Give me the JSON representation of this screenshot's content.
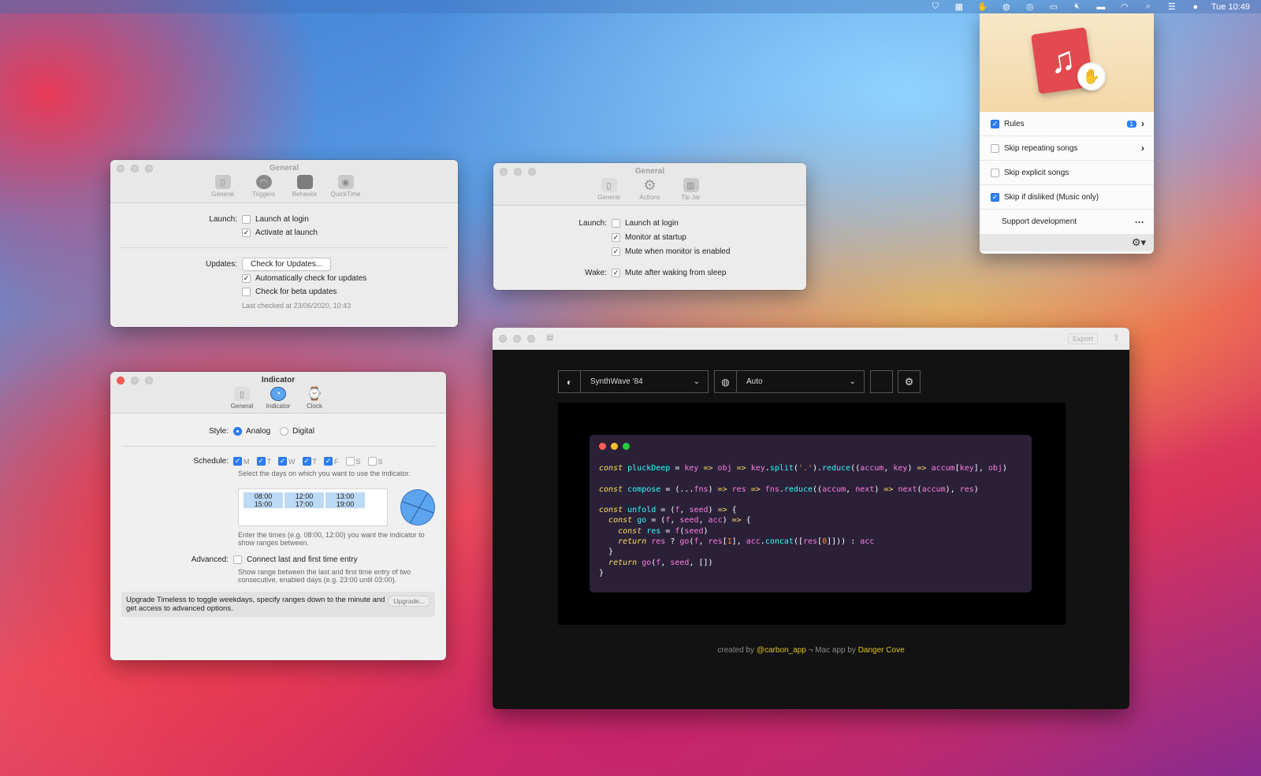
{
  "menubar": {
    "icons": [
      "shield-icon",
      "grid-icon",
      "hand-icon",
      "globe-icon",
      "target-icon",
      "display-icon",
      "mute-icon",
      "battery-icon",
      "wifi-icon",
      "search-icon",
      "control-center-icon",
      "siri-icon"
    ],
    "clock": "Tue 10:49"
  },
  "popover": {
    "items": [
      {
        "label": "Rules",
        "checked": true,
        "badge": "1",
        "chevron": true
      },
      {
        "label": "Skip repeating songs",
        "checked": false,
        "chevron": true
      },
      {
        "label": "Skip explicit songs",
        "checked": false
      },
      {
        "label": "Skip if disliked (Music only)",
        "checked": true
      },
      {
        "label": "Support development",
        "more": "···"
      }
    ]
  },
  "win_general1": {
    "title": "General",
    "tabs": [
      "General",
      "Triggers",
      "Behavior",
      "QuickTime"
    ],
    "launch_label": "Launch:",
    "launch_at_login": "Launch at login",
    "activate_at_launch": "Activate at launch",
    "updates_label": "Updates:",
    "check_updates_button": "Check for Updates...",
    "auto_check": "Automatically check for updates",
    "beta": "Check for beta updates",
    "last_checked": "Last checked at 23/06/2020, 10:43"
  },
  "win_general2": {
    "title": "General",
    "tabs": [
      "General",
      "Actions",
      "Tip Jar"
    ],
    "launch_label": "Launch:",
    "launch_at_login": "Launch at login",
    "monitor_startup": "Monitor at startup",
    "mute_enabled": "Mute when monitor is enabled",
    "wake_label": "Wake:",
    "mute_wake": "Mute after waking from sleep"
  },
  "win_indicator": {
    "title": "Indicator",
    "tabs": [
      "General",
      "Indicator",
      "Clock"
    ],
    "style_label": "Style:",
    "analog": "Analog",
    "digital": "Digital",
    "schedule_label": "Schedule:",
    "days": [
      {
        "d": "M",
        "on": true
      },
      {
        "d": "T",
        "on": true
      },
      {
        "d": "W",
        "on": true
      },
      {
        "d": "T",
        "on": true
      },
      {
        "d": "F",
        "on": true
      },
      {
        "d": "S",
        "on": false
      },
      {
        "d": "S",
        "on": false
      }
    ],
    "schedule_hint": "Select the days on which you want to use the indicator.",
    "times": [
      "08:00",
      "12:00",
      "13:00",
      "15:00",
      "17:00",
      "19:00"
    ],
    "times_hint": "Enter the times (e.g. 08:00, 12:00) you want the indicator to show ranges between.",
    "advanced_label": "Advanced:",
    "connect": "Connect last and first time entry",
    "advanced_hint": "Show range between the last and first time entry of two consecutive, enabled days (e.g. 23:00 until 03:00).",
    "upgrade_text": "Upgrade Timeless to toggle weekdays, specify ranges down to the minute and get access to advanced options.",
    "upgrade_button": "Upgrade..."
  },
  "carbon": {
    "export": "Export",
    "theme": "SynthWave '84",
    "language": "Auto",
    "code_lines": [
      [
        [
          "kw",
          "const"
        ],
        [
          "t",
          " "
        ],
        [
          "fn",
          "pluckDeep"
        ],
        [
          "t",
          " = "
        ],
        [
          "pm",
          "key"
        ],
        [
          "op",
          " => "
        ],
        [
          "pm",
          "obj"
        ],
        [
          "op",
          " => "
        ],
        [
          "pm",
          "key"
        ],
        [
          "t",
          "."
        ],
        [
          "fn",
          "split"
        ],
        [
          "t",
          "("
        ],
        [
          "st",
          "'.'"
        ],
        [
          "t",
          ")."
        ],
        [
          "fn",
          "reduce"
        ],
        [
          "t",
          "(("
        ],
        [
          "pm",
          "accum"
        ],
        [
          "t",
          ", "
        ],
        [
          "pm",
          "key"
        ],
        [
          "t",
          ")"
        ],
        [
          "op",
          " => "
        ],
        [
          "pm",
          "accum"
        ],
        [
          "t",
          "["
        ],
        [
          "pm",
          "key"
        ],
        [
          "t",
          "], "
        ],
        [
          "pm",
          "obj"
        ],
        [
          "t",
          ")"
        ]
      ],
      [],
      [
        [
          "kw",
          "const"
        ],
        [
          "t",
          " "
        ],
        [
          "fn",
          "compose"
        ],
        [
          "t",
          " = (..."
        ],
        [
          "pm",
          "fns"
        ],
        [
          "t",
          ")"
        ],
        [
          "op",
          " => "
        ],
        [
          "pm",
          "res"
        ],
        [
          "op",
          " => "
        ],
        [
          "pm",
          "fns"
        ],
        [
          "t",
          "."
        ],
        [
          "fn",
          "reduce"
        ],
        [
          "t",
          "(("
        ],
        [
          "pm",
          "accum"
        ],
        [
          "t",
          ", "
        ],
        [
          "pm",
          "next"
        ],
        [
          "t",
          ")"
        ],
        [
          "op",
          " => "
        ],
        [
          "pm",
          "next"
        ],
        [
          "t",
          "("
        ],
        [
          "pm",
          "accum"
        ],
        [
          "t",
          "), "
        ],
        [
          "pm",
          "res"
        ],
        [
          "t",
          ")"
        ]
      ],
      [],
      [
        [
          "kw",
          "const"
        ],
        [
          "t",
          " "
        ],
        [
          "fn",
          "unfold"
        ],
        [
          "t",
          " = ("
        ],
        [
          "pm",
          "f"
        ],
        [
          "t",
          ", "
        ],
        [
          "pm",
          "seed"
        ],
        [
          "t",
          ")"
        ],
        [
          "op",
          " => "
        ],
        [
          "t",
          "{"
        ]
      ],
      [
        [
          "t",
          "  "
        ],
        [
          "kw",
          "const"
        ],
        [
          "t",
          " "
        ],
        [
          "fn",
          "go"
        ],
        [
          "t",
          " = ("
        ],
        [
          "pm",
          "f"
        ],
        [
          "t",
          ", "
        ],
        [
          "pm",
          "seed"
        ],
        [
          "t",
          ", "
        ],
        [
          "pm",
          "acc"
        ],
        [
          "t",
          ")"
        ],
        [
          "op",
          " => "
        ],
        [
          "t",
          "{"
        ]
      ],
      [
        [
          "t",
          "    "
        ],
        [
          "kw",
          "const"
        ],
        [
          "t",
          " "
        ],
        [
          "fn",
          "res"
        ],
        [
          "t",
          " = "
        ],
        [
          "pm",
          "f"
        ],
        [
          "t",
          "("
        ],
        [
          "pm",
          "seed"
        ],
        [
          "t",
          ")"
        ]
      ],
      [
        [
          "t",
          "    "
        ],
        [
          "kw",
          "return"
        ],
        [
          "t",
          " "
        ],
        [
          "pm",
          "res"
        ],
        [
          "t",
          " ? "
        ],
        [
          "pm",
          "go"
        ],
        [
          "t",
          "("
        ],
        [
          "pm",
          "f"
        ],
        [
          "t",
          ", "
        ],
        [
          "pm",
          "res"
        ],
        [
          "t",
          "["
        ],
        [
          "st",
          "1"
        ],
        [
          "t",
          "], "
        ],
        [
          "pm",
          "acc"
        ],
        [
          "t",
          "."
        ],
        [
          "fn",
          "concat"
        ],
        [
          "t",
          "(["
        ],
        [
          "pm",
          "res"
        ],
        [
          "t",
          "["
        ],
        [
          "st",
          "0"
        ],
        [
          "t",
          "]])) : "
        ],
        [
          "pm",
          "acc"
        ]
      ],
      [
        [
          "t",
          "  }"
        ]
      ],
      [
        [
          "t",
          "  "
        ],
        [
          "kw",
          "return"
        ],
        [
          "t",
          " "
        ],
        [
          "pm",
          "go"
        ],
        [
          "t",
          "("
        ],
        [
          "pm",
          "f"
        ],
        [
          "t",
          ", "
        ],
        [
          "pm",
          "seed"
        ],
        [
          "t",
          ", [])"
        ]
      ],
      [
        [
          "t",
          "}"
        ]
      ]
    ],
    "credit_pre": "created by ",
    "credit_handle": "@carbon_app",
    "credit_mid": " ¬ Mac app by ",
    "credit_author": "Danger Cove"
  }
}
